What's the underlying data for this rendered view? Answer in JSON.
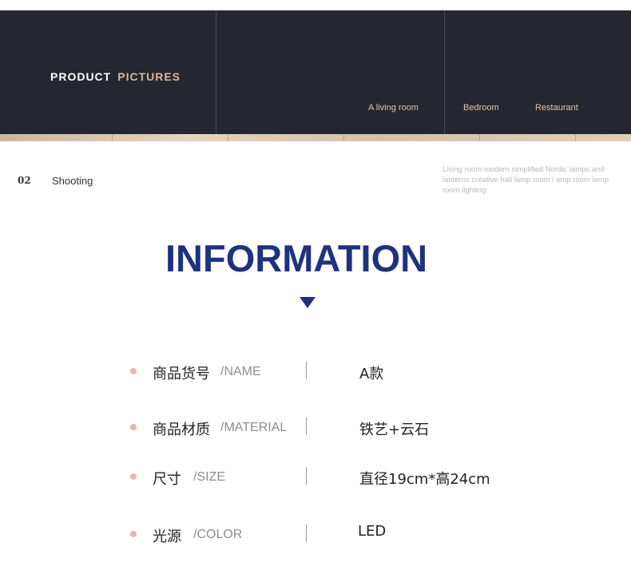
{
  "banner": {
    "title_primary": "PRODUCT",
    "title_accent": "PICTURES",
    "rooms": [
      "A living room",
      "Bedroom",
      "Restaurant"
    ]
  },
  "shooting": {
    "number": "02",
    "label": "Shooting",
    "description": "Living room modern simplified Nordic lamps and lanterns creative hall lamp room l amp room lamp room lighting"
  },
  "info": {
    "title": "INFORMATION",
    "rows": [
      {
        "label_cn": "商品货号",
        "label_en": "/NAME",
        "value": "A款"
      },
      {
        "label_cn": "商品材质",
        "label_en": "/MATERIAL",
        "value": "铁艺+云石"
      },
      {
        "label_cn": "尺寸",
        "label_en": "/SIZE",
        "value": "直径19cm*高24cm"
      },
      {
        "label_cn": "光源",
        "label_en": "/COLOR",
        "value": "LED"
      }
    ]
  },
  "colors": {
    "banner_bg": "#242730",
    "accent": "#d9b99d",
    "title_blue": "#1f3280",
    "bullet_pink": "#e9b3b1"
  }
}
